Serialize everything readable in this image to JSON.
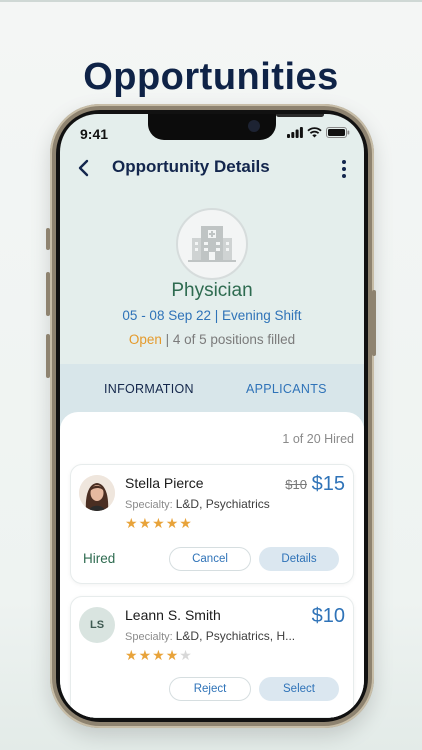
{
  "hero": {
    "title": "Opportunities"
  },
  "status_bar": {
    "time": "9:41"
  },
  "nav": {
    "title": "Opportunity Details",
    "back_icon": "back-chevron-icon",
    "more_icon": "more-vertical-icon"
  },
  "opportunity": {
    "icon": "hospital-icon",
    "role": "Physician",
    "dates": "05 - 08 Sep 22 | Evening Shift",
    "status": "Open",
    "positions": " | 4 of 5 positions filled"
  },
  "tabs": [
    {
      "label": "INFORMATION",
      "active": true
    },
    {
      "label": "APPLICANTS",
      "active": false
    }
  ],
  "applicants": {
    "hired_count": "1 of 20 Hired",
    "items": [
      {
        "name": "Stella Pierce",
        "specialty_label": "Specialty: ",
        "specialty": "L&D, Psychiatrics",
        "rating": 5,
        "old_price": "$10",
        "price": "$15",
        "status": "Hired",
        "buttons": [
          "Cancel",
          "Details"
        ]
      },
      {
        "name": "Leann S. Smith",
        "initials": "LS",
        "specialty_label": "Specialty: ",
        "specialty": "L&D, Psychiatrics, H...",
        "rating": 4,
        "price": "$10",
        "buttons": [
          "Reject",
          "Select"
        ]
      }
    ]
  },
  "colors": {
    "accent": "#2f73b8",
    "navy": "#13264d",
    "green": "#2e6b50",
    "orange": "#e49a2c",
    "star": "#e8a33a"
  }
}
